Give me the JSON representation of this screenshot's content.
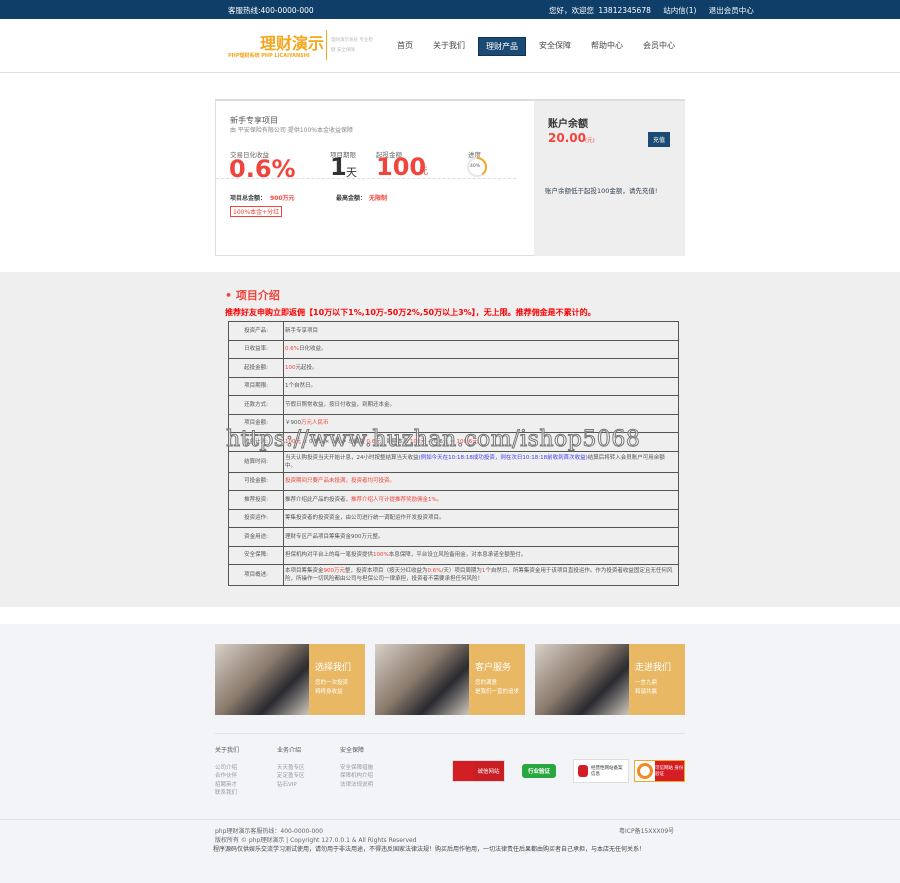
{
  "topbar": {
    "hotline": "客服热线:400-0000-000",
    "greeting": "您好，欢迎您 13812345678",
    "messages": "站内信(1)",
    "logout": "退出会员中心"
  },
  "logo": {
    "title": "理财演示",
    "sub": "PHP理财系统  PHP LICAIYANSHI",
    "slogan": "理财演示系统 专业稳健 安全保障"
  },
  "nav": [
    "首页",
    "关于我们",
    "理财产品",
    "安全保障",
    "帮助中心",
    "会员中心"
  ],
  "nav_active": 2,
  "project": {
    "title": "新手专享项目",
    "guarantee": "由 平安保险有限公司 提供100%本金收益保障",
    "rate_label": "交易日化收益",
    "rate": "0.6%",
    "term_label": "项目期限",
    "term": "1",
    "term_unit": "天",
    "min_label": "起投金额",
    "min": "100",
    "min_unit": "元",
    "progress_label": "进度",
    "progress": "40%",
    "progress_value": 40,
    "total_label": "项目总金额：",
    "total": "900万元",
    "max_label": "最高金额：",
    "max": "无限制",
    "tag": "100%本金+分红"
  },
  "account": {
    "title": "账户余额",
    "balance": "20.00",
    "unit": "(元)",
    "recharge": "充值",
    "notice": "账户余额低于起投100金额，请先充值!"
  },
  "intro": {
    "title": "• 项目介绍",
    "promo": "推荐好友申购立即返佣【10万以下1%,10万-50万2%,50万以上3%】，无上限。推荐佣金是不累计的。",
    "rows": [
      {
        "label": "投资产品:",
        "segs": [
          {
            "t": "新手专享项目"
          }
        ]
      },
      {
        "label": "日收益率:",
        "segs": [
          {
            "t": "0.6%",
            "c": "red"
          },
          {
            "t": "日化收益。"
          }
        ]
      },
      {
        "label": "起投金额:",
        "segs": [
          {
            "t": "100",
            "c": "red"
          },
          {
            "t": "元起投。"
          }
        ]
      },
      {
        "label": "项目期限:",
        "segs": [
          {
            "t": "1个自然日。"
          }
        ]
      },
      {
        "label": "还款方式:",
        "segs": [
          {
            "t": "节假日照常收益，按日付收益，到期还本金。"
          }
        ]
      },
      {
        "label": "项目金额:",
        "segs": [
          {
            "t": "￥900"
          },
          {
            "t": "万元人民币",
            "c": "red"
          }
        ]
      },
      {
        "label": "收益计算:",
        "segs": [
          {
            "t": "100元",
            "c": "red"
          },
          {
            "t": " × 0.6% × 1天 = 总收益 "
          },
          {
            "t": "0.6",
            "c": "red"
          },
          {
            "t": "元，到期本息 "
          },
          {
            "t": "100",
            "c": "red"
          },
          {
            "t": "元 + 0.6元 = "
          },
          {
            "t": "100.6元",
            "c": "red"
          }
        ]
      },
      {
        "label": "结算时间:",
        "segs": [
          {
            "t": "当天认购投资当天开始计息，24小时按整结算当天收益"
          },
          {
            "t": "(例如今天在10:18:18成功投资，则在次日10:18:18前收到首次收益)",
            "c": "blue"
          },
          {
            "t": "结算后将转入会员账户可用余额中。"
          }
        ]
      },
      {
        "label": "可投金额:",
        "segs": [
          {
            "t": "投资期间只要产品未投满，投资者均可投资。",
            "c": "red"
          }
        ]
      },
      {
        "label": "推荐投资:",
        "segs": [
          {
            "t": "推荐介绍此产品的投资者，"
          },
          {
            "t": "推荐介绍人可计提推荐奖励佣金1%。",
            "c": "red"
          }
        ]
      },
      {
        "label": "投资运作:",
        "segs": [
          {
            "t": "筹集投资者的投资资金，由公司进行统一调配运作开发投资项目。"
          }
        ]
      },
      {
        "label": "资金用途:",
        "segs": [
          {
            "t": "理财专区产品项目筹集资金900万元整。"
          }
        ]
      },
      {
        "label": "安全保障:",
        "segs": [
          {
            "t": "担保机构对平台上的每一笔投资提供"
          },
          {
            "t": "100%",
            "c": "red"
          },
          {
            "t": "本息保障，平台设立风险备用金，对本息承诺全额垫付。"
          }
        ]
      },
      {
        "label": "项目概述:",
        "segs": [
          {
            "t": "本项目筹集资金"
          },
          {
            "t": "900万元",
            "c": "red"
          },
          {
            "t": "整，投资本项目（按天分红收益为"
          },
          {
            "t": "0.6%",
            "c": "red"
          },
          {
            "t": "/天）项目周期为"
          },
          {
            "t": "1",
            "c": "red"
          },
          {
            "t": "个自然日，所筹集资金用于该项目直投运作。作为投资者收益固定且无任何风险，所操作一切风险都由公司与担保公司一律承担，投资者不需要承担任何风险！"
          }
        ]
      }
    ]
  },
  "watermark": "https://www.huzhan.com/ishop5068",
  "promos": [
    {
      "title": "选择我们",
      "l1": "您的一次投资",
      "l2": "将终身收益"
    },
    {
      "title": "客户服务",
      "l1": "您的满意",
      "l2": "是我们一直的追求"
    },
    {
      "title": "走进我们",
      "l1": "一言九鼎",
      "l2": "和谐共赢"
    }
  ],
  "footer_cols": [
    {
      "title": "关于我们",
      "items": [
        "公司介绍",
        "合作伙伴",
        "招聘英才",
        "联系我们"
      ]
    },
    {
      "title": "业务介绍",
      "items": [
        "天天盈专区",
        "定定盈专区",
        "钻石VIP"
      ]
    },
    {
      "title": "安全保障",
      "items": [
        "安全保障措施",
        "保障机构介绍",
        "法律法规说明"
      ]
    }
  ],
  "badges": [
    "诚信网站",
    "行业验证",
    "经营性网站备案信息",
    "可信网站 身份验证"
  ],
  "bottom": {
    "hotline": "php理财演示客服热线：400-0000-000",
    "copyright": "版权所有 © php理财演示 | Copyright 127.0.0.1 & All Rights Reserved",
    "icp": "粤ICP备15XXX09号",
    "disclaimer": "程序源码仅供娱乐交流学习测试使用，请勿用于非法用途，不得违反国家法律法规！购买后用作他用，一切法律责任后果都由购买者自己承担，与本店无任何关系！"
  },
  "colors": {
    "navy": "#0f3f69",
    "red": "#f0443c",
    "gold": "#e9b865"
  }
}
